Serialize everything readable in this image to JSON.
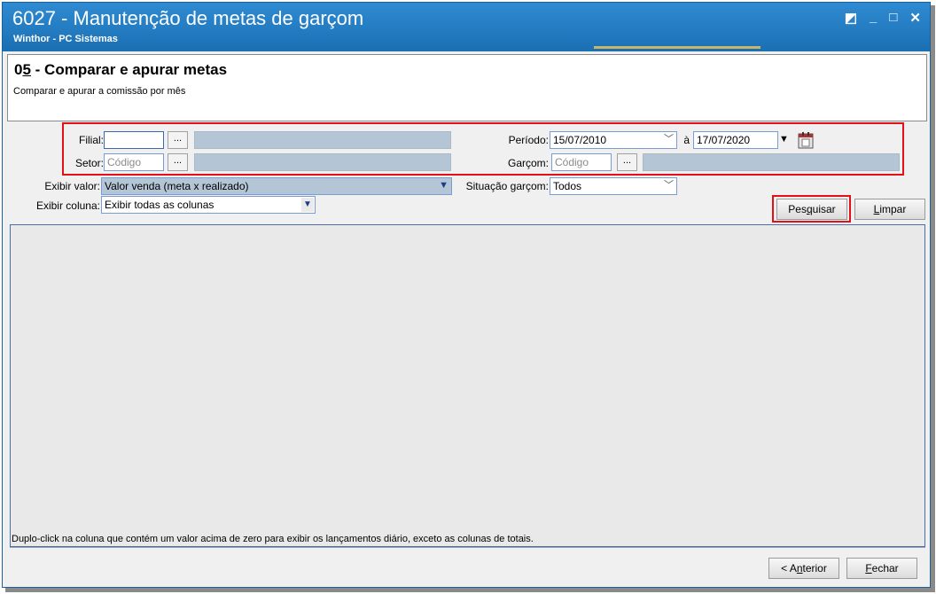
{
  "window": {
    "title": "6027 - Manutenção de metas de garçom",
    "subtitle": "Winthor - PC Sistemas",
    "controls": [
      "◩",
      "_",
      "□",
      "✕"
    ]
  },
  "header": {
    "step_prefix": "0",
    "step_underlined": "5",
    "step_rest": " - Comparar e apurar metas",
    "description": "Comparar e apurar a comissão por mês"
  },
  "filters": {
    "filial_label": "Filial:",
    "filial_value": "",
    "setor_label": "Setor:",
    "setor_placeholder": "Código",
    "periodo_label": "Período:",
    "periodo_start": "15/07/2010",
    "periodo_sep": "à",
    "periodo_end": "17/07/2020",
    "garcom_label": "Garçom:",
    "garcom_placeholder": "Código",
    "exibir_valor_label": "Exibir valor:",
    "exibir_valor_selected": "Valor venda (meta x realizado)",
    "situacao_label": "Situação garçom:",
    "situacao_selected": "Todos",
    "exibir_coluna_label": "Exibir coluna:",
    "exibir_coluna_selected": "Exibir todas as colunas",
    "dots": "..."
  },
  "buttons": {
    "pesquisar_pre": "Pes",
    "pesquisar_u": "q",
    "pesquisar_post": "uisar",
    "limpar_u": "L",
    "limpar_post": "impar",
    "anterior_pre": "< A",
    "anterior_u": "n",
    "anterior_post": "terior",
    "fechar_u": "F",
    "fechar_post": "echar"
  },
  "grid": {
    "hint": "Duplo-click na coluna que contém um valor acima de zero para exibir os lançamentos diário, exceto as colunas de totais."
  },
  "colors": {
    "title_bar": "#1b6fb3",
    "highlight": "#e3101a",
    "readonly_field": "#b4c6d6"
  }
}
